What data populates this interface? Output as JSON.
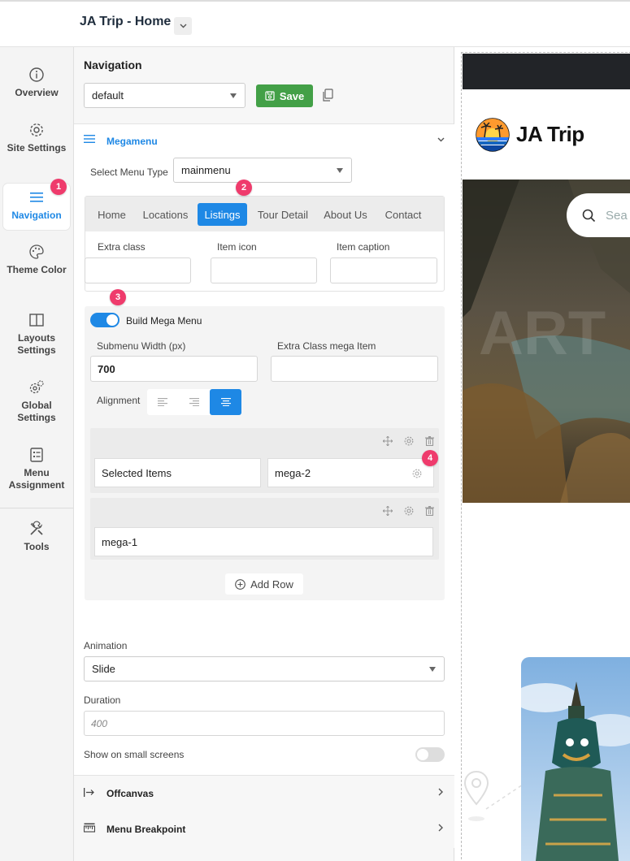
{
  "header": {
    "title": "JA Trip - Home"
  },
  "sidebar": {
    "items": [
      {
        "label": "Overview",
        "icon": "info-icon"
      },
      {
        "label": "Site Settings",
        "icon": "gear-icon"
      },
      {
        "label": "Navigation",
        "icon": "menu-icon",
        "active": true
      },
      {
        "label": "Theme Color",
        "icon": "palette-icon"
      },
      {
        "label": "Layouts Settings",
        "icon": "layout-icon"
      },
      {
        "label": "Global Settings",
        "icon": "gears-icon"
      },
      {
        "label": "Menu Assignment",
        "icon": "list-icon"
      },
      {
        "label": "Tools",
        "icon": "tools-icon"
      }
    ]
  },
  "badges": [
    "1",
    "2",
    "3",
    "4"
  ],
  "panel": {
    "title": "Navigation",
    "preset_value": "default",
    "save_label": "Save",
    "megamenu": {
      "title": "Megamenu",
      "menu_type_label": "Select Menu Type",
      "menu_type_value": "mainmenu",
      "tabs": [
        "Home",
        "Locations",
        "Listings",
        "Tour Detail",
        "About Us",
        "Contact"
      ],
      "active_tab": "Listings",
      "extra_class_label": "Extra class",
      "item_icon_label": "Item icon",
      "item_caption_label": "Item caption",
      "build_mega_label": "Build Mega Menu",
      "build_mega_on": true,
      "submenu_width_label": "Submenu Width (px)",
      "submenu_width_value": "700",
      "extra_class_mega_label": "Extra Class mega Item",
      "alignment_label": "Alignment",
      "alignment_active": "center",
      "rows": [
        {
          "cols": [
            "Selected Items",
            "mega-2"
          ]
        },
        {
          "cols": [
            "mega-1"
          ]
        }
      ],
      "add_row_label": "Add Row",
      "animation_label": "Animation",
      "animation_value": "Slide",
      "duration_label": "Duration",
      "duration_placeholder": "400",
      "small_screens_label": "Show on small screens",
      "small_screens_on": false
    },
    "offcanvas_label": "Offcanvas",
    "breakpoint_label": "Menu Breakpoint"
  },
  "preview": {
    "logo_text": "JA Trip",
    "search_placeholder": "Sea"
  },
  "colors": {
    "accent": "#1e88e5",
    "save": "#43a047",
    "badge": "#ef3b6c"
  }
}
